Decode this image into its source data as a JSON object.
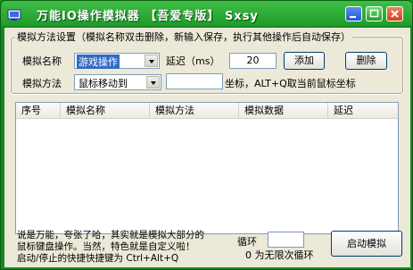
{
  "window": {
    "title": "万能IO操作模拟器 【吾爱专版】 Sxsy"
  },
  "group": {
    "title": "模拟方法设置（模拟名称双击删除，新输入保存，执行其他操作后自动保存）",
    "name_label": "模拟名称",
    "name_value": "游戏操作",
    "delay_label": "延迟（ms）",
    "delay_value": "20",
    "add_label": "添加",
    "delete_label": "删除",
    "method_label": "模拟方法",
    "method_value": "鼠标移动到",
    "coord_value": "",
    "coord_hint": "坐标，ALT+Q取当前鼠标坐标"
  },
  "table": {
    "columns": [
      "序号",
      "模拟名称",
      "模拟方法",
      "模拟数据",
      "延迟"
    ]
  },
  "footer": {
    "desc_line1": "说是万能，夸张了哈，其实就是模拟大部分的",
    "desc_line2": "鼠标键盘操作。当然，特色就是自定义啦！",
    "desc_line3": "启动/停止的快捷快捷键为 Ctrl+Alt+Q",
    "loop_label": "循环",
    "loop_value": "",
    "loop_hint": "0 为无限次循环",
    "start_label": "启动模拟"
  },
  "colors": {
    "titlebar": "#1f9b2b",
    "client": "#ece9d8"
  },
  "icons": [
    "app-icon",
    "minimize-icon",
    "maximize-icon",
    "close-icon",
    "dropdown-arrow-icon"
  ]
}
